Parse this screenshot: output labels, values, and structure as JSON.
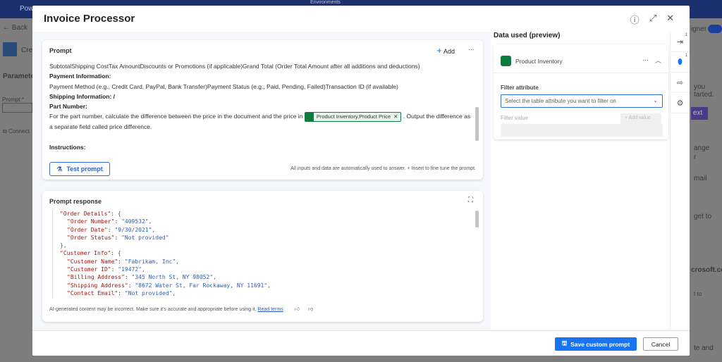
{
  "background": {
    "app_name": "Pow",
    "back": "Back",
    "flow_name": "Crea",
    "tab": "Parameters",
    "prompt_label": "Prompt *",
    "connections": "Connect",
    "environments": "Environments",
    "designer": "igner",
    "right_texts": [
      "you",
      "tarted.",
      "ext",
      "ange",
      "r",
      "mail",
      "get to",
      "crosoft.com",
      "t to",
      "te and"
    ]
  },
  "modal": {
    "title": "Invoice Processor",
    "icons": [
      "help-icon",
      "expand-icon",
      "close-icon"
    ]
  },
  "prompt": {
    "title": "Prompt",
    "add_label": "Add",
    "line1": "SubtotalShipping CostTax AmountDiscounts or Promotions (if applicable)Grand Total (Order Total Amount after all additions and deductions)",
    "h_payment": "Payment Information:",
    "line2": "Payment Method (e.g., Credit Card, PayPal, Bank Transfer)Payment Status (e.g., Paid, Pending, Failed)Transaction ID (if available)",
    "h_shipping": "Shipping Information: /",
    "h_part": "Part Number:",
    "part_before": "For the part number, calculate the difference between the price in the document and the price in",
    "chip": "Product Inventory.Product Price",
    "part_after": ". Output the difference as a separate field called price difference.",
    "h_instructions": "Instructions:",
    "test_button": "Test prompt",
    "hint": "All inputs and data are automatically used to answer. + Insert to fine tune the prompt."
  },
  "response": {
    "title": "Prompt response",
    "lines": [
      {
        "indent": 0,
        "key": "\"Order Details\"",
        "val": "{",
        "type": "open"
      },
      {
        "indent": 1,
        "key": "\"Order Number\"",
        "val": "\"409532\","
      },
      {
        "indent": 1,
        "key": "\"Order Date\"",
        "val": "\"9/30/2021\","
      },
      {
        "indent": 1,
        "key": "\"Order Status\"",
        "val": "\"Not provided\""
      },
      {
        "indent": 0,
        "key": "",
        "val": "},",
        "type": "close"
      },
      {
        "indent": 0,
        "key": "\"Customer Info\"",
        "val": "{",
        "type": "open"
      },
      {
        "indent": 1,
        "key": "\"Customer Name\"",
        "val": "\"Fabrikam, Inc\","
      },
      {
        "indent": 1,
        "key": "\"Customer ID\"",
        "val": "\"19472\","
      },
      {
        "indent": 1,
        "key": "\"Billing Address\"",
        "val": "\"345 North St, NY 98052\","
      },
      {
        "indent": 1,
        "key": "\"Shipping Address\"",
        "val": "\"8672 Water St, Far Rockaway, NY 11691\","
      },
      {
        "indent": 1,
        "key": "\"Contact Email\"",
        "val": "\"Not provided\","
      }
    ],
    "disclaimer": "AI-generated content may be incorrect. Make sure it's accurate and appropriate before using it.",
    "read_terms": "Read terms"
  },
  "data_panel": {
    "title": "Data used (preview)",
    "source": "Product Inventory",
    "filter_attribute_label": "Filter attribute",
    "filter_attribute_placeholder": "Select the table attribute you want to filter on",
    "filter_value_label": "Filter value",
    "add_value": "+ Add value",
    "badges": [
      "1",
      "1"
    ]
  },
  "footer": {
    "save": "Save custom prompt",
    "cancel": "Cancel"
  },
  "colors": {
    "accent": "#1a73f0",
    "chip": "#0f7b3e"
  }
}
